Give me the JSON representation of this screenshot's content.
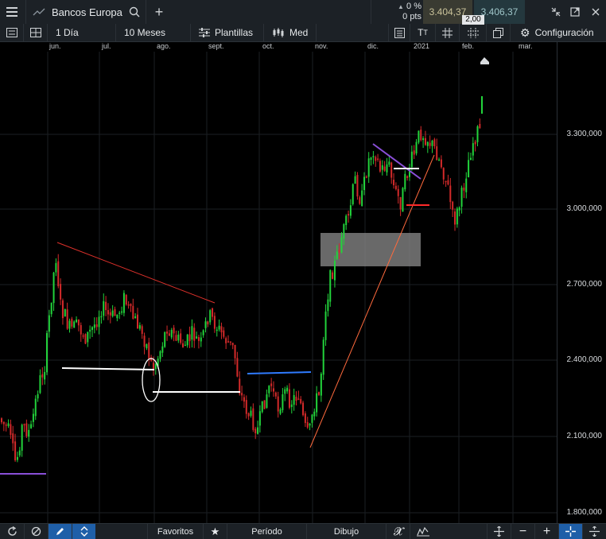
{
  "header": {
    "symbol_name": "Bancos Europa",
    "change_pct": "0 %",
    "change_pts": "0 pts",
    "bid": "3.404,37",
    "ask": "3.406,37",
    "spread": "2,00"
  },
  "toolbar": {
    "interval": "1 Día",
    "range": "10 Meses",
    "templates": "Plantillas",
    "chart_style": "Med",
    "settings": "Configuración"
  },
  "months": [
    "jun.",
    "jul.",
    "ago.",
    "sept.",
    "oct.",
    "nov.",
    "dic.",
    "2021",
    "feb.",
    "mar."
  ],
  "price_axis": [
    "3.300,000",
    "3.000,000",
    "2.700,000",
    "2.400,000",
    "2.100,000",
    "1.800,000"
  ],
  "bottombar": {
    "favorites": "Favoritos",
    "period": "Período",
    "drawing": "Dibujo"
  },
  "colors": {
    "up_candle": "#22d33b",
    "down_candle": "#d42a2a",
    "grid": "#1b1f23",
    "panel": "#1c2126"
  }
}
